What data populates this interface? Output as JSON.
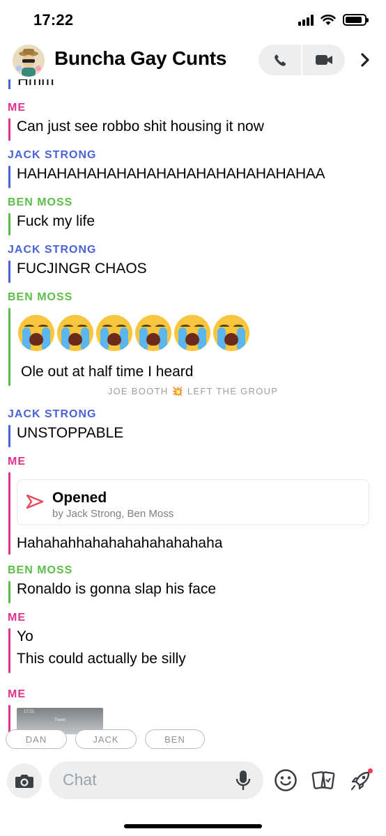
{
  "status_bar": {
    "time": "17:22",
    "battery_level": 0.9
  },
  "header": {
    "title": "Buncha Gay Cunts"
  },
  "partial_message": "Hmm",
  "messages": [
    {
      "sender": "ME",
      "lines": [
        "Can just see robbo shit housing it now"
      ]
    },
    {
      "sender": "JACK STRONG",
      "lines": [
        "HAHAHAHAHAHAHAHAHAHAHAHAHAHAHAA"
      ]
    },
    {
      "sender": "BEN MOSS",
      "lines": [
        "Fuck my life"
      ]
    },
    {
      "sender": "JACK STRONG",
      "lines": [
        "FUCJINGR CHAOS"
      ]
    },
    {
      "sender": "BEN MOSS",
      "emoji": "😭😭😭😭😭😭",
      "lines": [
        "Ole out at half time I heard"
      ]
    },
    {
      "sender": "JACK STRONG",
      "lines": [
        "UNSTOPPABLE"
      ]
    },
    {
      "sender": "ME",
      "lines": [
        "Hahahahhahahahahahahahaha"
      ]
    },
    {
      "sender": "BEN MOSS",
      "lines": [
        "Ronaldo is gonna slap his face"
      ]
    },
    {
      "sender": "ME",
      "lines": [
        "Yo",
        "This could actually be silly"
      ]
    },
    {
      "sender": "ME"
    }
  ],
  "system_message": {
    "before": "JOE BOOTH",
    "emoji": "💥",
    "after": "LEFT THE GROUP"
  },
  "opened_card": {
    "title": "Opened",
    "subtitle": "by Jack Strong, Ben Moss"
  },
  "thumbnail": {
    "time": "17:21",
    "label": "Tweet"
  },
  "typing_chips": [
    "DAN",
    "JACK",
    "BEN"
  ],
  "input": {
    "placeholder": "Chat"
  },
  "colors": {
    "me": "#E0318B",
    "jack": "#4A62D8",
    "ben": "#5BBE4A",
    "opened_arrow": "#E8475A",
    "notification_dot": "#F23C57"
  },
  "icons": [
    "phone-icon",
    "video-icon",
    "chevron-right-icon",
    "camera-icon",
    "mic-icon",
    "smiley-icon",
    "cards-icon",
    "rocket-icon",
    "crying-emoji-icon",
    "collision-emoji-icon",
    "send-arrow-icon"
  ]
}
